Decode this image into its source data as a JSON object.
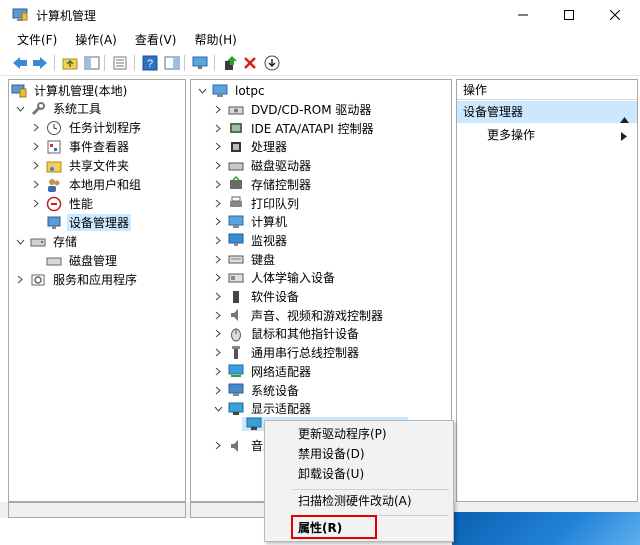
{
  "window": {
    "title": "计算机管理",
    "controls": {
      "minimize": "—",
      "maximize": "☐",
      "close": "✕"
    }
  },
  "menubar": [
    "文件(F)",
    "操作(A)",
    "查看(V)",
    "帮助(H)"
  ],
  "toolbar": [
    "back-icon",
    "forward-icon",
    "up-folder-icon",
    "show-tree-icon",
    "properties-icon",
    "help-icon",
    "show-action-icon",
    "monitor-icon",
    "update-driver-icon",
    "uninstall-icon",
    "download-icon"
  ],
  "left_tree": {
    "root": "计算机管理(本地)",
    "system_tools": "系统工具",
    "items": [
      "任务计划程序",
      "事件查看器",
      "共享文件夹",
      "本地用户和组",
      "性能",
      "设备管理器"
    ],
    "storage": "存储",
    "disk_mgmt": "磁盘管理",
    "services": "服务和应用程序"
  },
  "device_tree": {
    "root": "lotpc",
    "categories": [
      "DVD/CD-ROM 驱动器",
      "IDE ATA/ATAPI 控制器",
      "处理器",
      "磁盘驱动器",
      "存储控制器",
      "打印队列",
      "计算机",
      "监视器",
      "键盘",
      "人体学输入设备",
      "软件设备",
      "声音、视频和游戏控制器",
      "鼠标和其他指针设备",
      "通用串行总线控制器",
      "网络适配器",
      "系统设备",
      "显示适配器"
    ],
    "partial_item": "音乐"
  },
  "actions": {
    "header": "操作",
    "section": "设备管理器",
    "more": "更多操作"
  },
  "context_menu": {
    "items": [
      "更新驱动程序(P)",
      "禁用设备(D)",
      "卸载设备(U)"
    ],
    "scan": "扫描检测硬件改动(A)",
    "properties": "属性(R)"
  },
  "colors": {
    "selection": "#cce8ff",
    "highlight_border": "#e00000"
  }
}
